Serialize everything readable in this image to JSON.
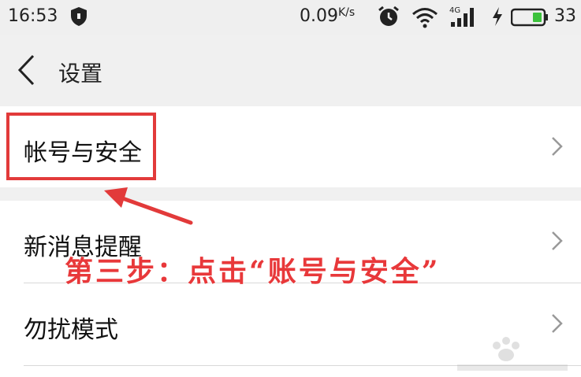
{
  "status_bar": {
    "time": "16:53",
    "network_speed": "0.09",
    "network_speed_unit": "K/s",
    "signal_type": "4G",
    "battery_percent": "33",
    "icons": [
      "shield-icon",
      "alarm-icon",
      "wifi-icon",
      "signal-icon",
      "charging-icon",
      "battery-icon"
    ]
  },
  "header": {
    "title": "设置",
    "back_icon": "chevron-left-icon"
  },
  "settings": {
    "items": [
      {
        "label": "帐号与安全"
      },
      {
        "label": "新消息提醒"
      },
      {
        "label": "勿扰模式"
      }
    ]
  },
  "annotation": {
    "text": "第三步：点击“账号与安全”",
    "color": "#e8383a"
  },
  "colors": {
    "background": "#f0f0f0",
    "list_background": "#ffffff",
    "highlight_red": "#e23a3a",
    "battery_green": "#3cc13c"
  }
}
